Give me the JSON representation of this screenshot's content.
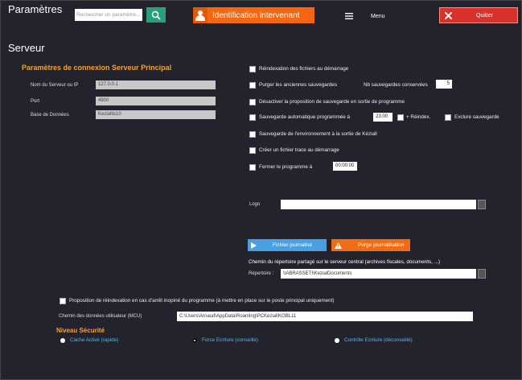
{
  "window": {
    "title": "Paramètres"
  },
  "toolbar": {
    "search_placeholder": "Rechercher un paramètre...",
    "identify_label": "Identification intervenant",
    "menu_label": "Menu",
    "quit_label": "Quitter"
  },
  "section_title": "Serveur",
  "connection": {
    "title": "Paramètres de connexion Serveur Principal",
    "fields": [
      {
        "label": "Nom du Serveur ou IP",
        "value": "127.0.0.1"
      },
      {
        "label": "Port",
        "value": "4900"
      },
      {
        "label": "Base de Données",
        "value": "Keziallis10"
      }
    ]
  },
  "options": {
    "reindex_startup": "Réindexation des fichiers au démarrage",
    "purge_backups": "Purger les anciennes sauvegardes",
    "backups_kept_label": "Nb sauvegardes conservées",
    "backups_kept_value": "5",
    "disable_backup_prompt": "Désactiver la proposition de sauvegarde en sortie de programme",
    "auto_backup": "Sauvegarde automatique programmée à",
    "auto_backup_time": "23:00",
    "plus_reindex": "+ Réindex.",
    "exclude_backup": "Exclure sauvegarde",
    "env_backup": "Sauvegarde de l'environnement à la sortie de Kéziall",
    "trace_file": "Créer un fichier trace au démarrage",
    "close_program": "Fermer le programme à",
    "close_time": "00:00:00"
  },
  "logo_label": "Logo",
  "actions": {
    "journal_label": "Fichier journalisé",
    "purge_label": "Purge journalisation"
  },
  "shared_dir": {
    "title": "Chemin du répertoire partagé sur le serveur central (archives fiscales, documents, ...)",
    "label": "Répertoire :",
    "value": "\\\\ABRASSETI\\KezialDocuments"
  },
  "reindex_prompt": "Proposition de réindexation en cas d'arrêt inopiné du programme (à mettre en place sur le poste principal uniquement)",
  "user_data": {
    "label": "Chemin des données utilisateur (MCU)",
    "value": "C:\\Users\\Arnaud\\AppData\\Roaming\\PCKezial\\KOBL11"
  },
  "security": {
    "title": "Niveau Sécurité",
    "options": [
      "Cache Activé (rapide)",
      "Force Ecriture (conseillé)",
      "Contrôle Ecriture (déconseillé)"
    ]
  }
}
